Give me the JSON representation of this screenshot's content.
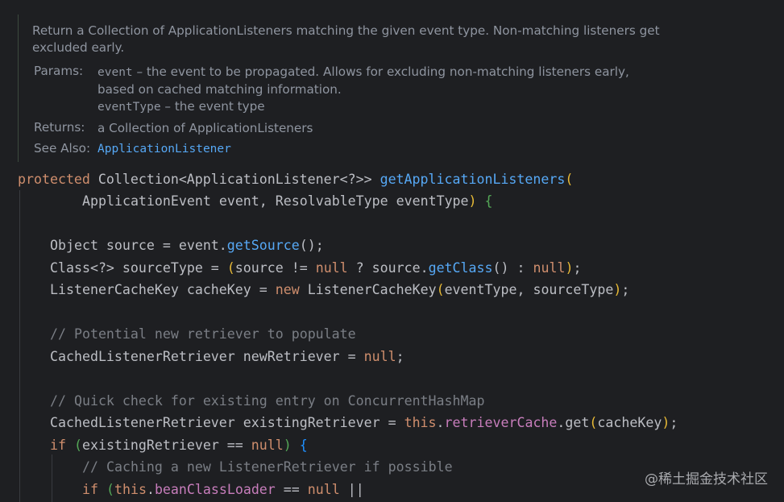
{
  "doc": {
    "summary": "Return a Collection of ApplicationListeners matching the given event type. Non-matching listeners get excluded early.",
    "params_label": "Params:",
    "param1_name": "event",
    "param1_desc_line1": " – the event to be propagated. Allows for excluding non-matching listeners early,",
    "param1_desc_line2": "based on cached matching information.",
    "param2_name": "eventType",
    "param2_desc": " – the event type",
    "returns_label": "Returns:",
    "returns_text": "a Collection of ApplicationListeners",
    "see_also_label": "See Also:",
    "see_also_link": "ApplicationListener"
  },
  "code": {
    "l1_kw": "protected",
    "l1_type": " Collection<ApplicationListener<?>> ",
    "l1_fn": "getApplicationListeners",
    "l1_paren": "(",
    "l2_params": "ApplicationEvent event, ResolvableType eventType",
    "l2_paren": ")",
    "l2_brace": " {",
    "l3_a": "Object source = event.",
    "l3_fn": "getSource",
    "l3_b": "();",
    "l4_a": "Class<?> sourceType = ",
    "l4_p1": "(",
    "l4_b": "source != ",
    "l4_null1": "null",
    "l4_c": " ? source.",
    "l4_fn": "getClass",
    "l4_d": "() : ",
    "l4_null2": "null",
    "l4_p2": ")",
    "l4_e": ";",
    "l5_a": "ListenerCacheKey cacheKey = ",
    "l5_new": "new",
    "l5_b": " ListenerCacheKey",
    "l5_p1": "(",
    "l5_c": "eventType, sourceType",
    "l5_p2": ")",
    "l5_d": ";",
    "l6_comment": "// Potential new retriever to populate",
    "l7_a": "CachedListenerRetriever newRetriever = ",
    "l7_null": "null",
    "l7_b": ";",
    "l8_comment": "// Quick check for existing entry on ConcurrentHashMap",
    "l9_a": "CachedListenerRetriever existingRetriever = ",
    "l9_this": "this",
    "l9_dot": ".",
    "l9_field": "retrieverCache",
    "l9_b": ".get",
    "l9_p1": "(",
    "l9_c": "cacheKey",
    "l9_p2": ")",
    "l9_d": ";",
    "l10_if": "if",
    "l10_p1": " (",
    "l10_a": "existingRetriever == ",
    "l10_null": "null",
    "l10_p2": ")",
    "l10_brace": " {",
    "l11_comment": "// Caching a new ListenerRetriever if possible",
    "l12_if": "if",
    "l12_p1": " (",
    "l12_this": "this",
    "l12_dot": ".",
    "l12_field": "beanClassLoader",
    "l12_a": " == ",
    "l12_null": "null",
    "l12_b": " ||"
  },
  "watermark": "@稀土掘金技术社区",
  "colors": {
    "background": "#1e1f22",
    "keyword": "#cf8e6d",
    "function": "#56a8f5",
    "field": "#c77dbb",
    "comment": "#7a7e85",
    "text": "#bcbec4",
    "doc_text": "#8f95a0"
  }
}
